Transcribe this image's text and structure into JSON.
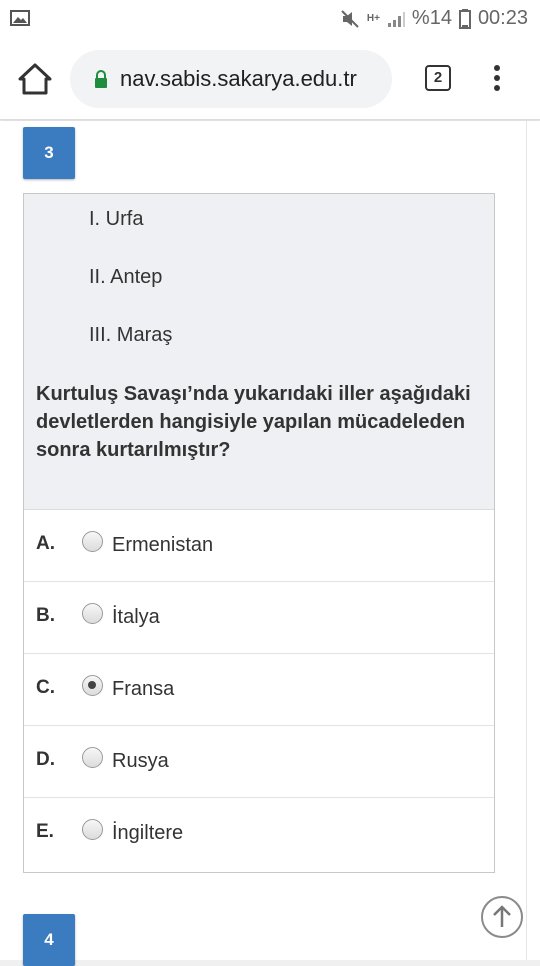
{
  "status_bar": {
    "battery_percent": "%14",
    "time": "00:23",
    "network": "H+"
  },
  "browser": {
    "url": "nav.sabis.sakarya.edu.tr",
    "tab_count": "2"
  },
  "question": {
    "number": "3",
    "items": [
      "I. Urfa",
      "II. Antep",
      "III. Maraş"
    ],
    "text": "Kurtuluş Savaşı’nda yukarıdaki iller aşağıdaki devletlerden hangisiyle yapılan mücadeleden sonra kurtarılmıştır?",
    "options": [
      {
        "letter": "A.",
        "text": "Ermenistan",
        "selected": false
      },
      {
        "letter": "B.",
        "text": "İtalya",
        "selected": false
      },
      {
        "letter": "C.",
        "text": "Fransa",
        "selected": true
      },
      {
        "letter": "D.",
        "text": "Rusya",
        "selected": false
      },
      {
        "letter": "E.",
        "text": "İngiltere",
        "selected": false
      }
    ]
  },
  "next_question": {
    "number": "4"
  }
}
